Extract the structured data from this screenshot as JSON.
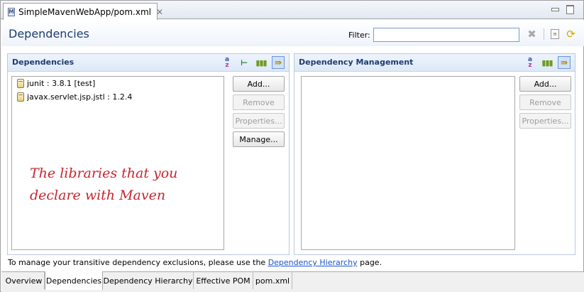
{
  "window": {
    "tab_title": "SimpleMavenWebApp/pom.xml",
    "tab_icon": "maven-m-icon",
    "close_glyph": "✕"
  },
  "header": {
    "title": "Dependencies",
    "filter_label": "Filter:",
    "filter_value": ""
  },
  "dependencies": {
    "title": "Dependencies",
    "items": [
      {
        "label": "junit : 3.8.1 [test]"
      },
      {
        "label": "javax.servlet.jsp.jstl : 1.2.4"
      }
    ],
    "buttons": {
      "add": "Add...",
      "remove": "Remove",
      "properties": "Properties...",
      "manage": "Manage..."
    }
  },
  "dependency_management": {
    "title": "Dependency Management",
    "items": [],
    "buttons": {
      "add": "Add...",
      "remove": "Remove",
      "properties": "Properties..."
    }
  },
  "annotation": {
    "line1": "The libraries that you",
    "line2": "declare with Maven",
    "color": "#c8242f"
  },
  "info": {
    "prefix": "To manage your transitive dependency exclusions, please use the ",
    "link": "Dependency Hierarchy",
    "suffix": " page."
  },
  "page_tabs": [
    {
      "label": "Overview",
      "active": false
    },
    {
      "label": "Dependencies",
      "active": true
    },
    {
      "label": "Dependency Hierarchy",
      "active": false
    },
    {
      "label": "Effective POM",
      "active": false
    },
    {
      "label": "pom.xml",
      "active": false
    }
  ],
  "colors": {
    "title_blue": "#1f3c6e",
    "link_blue": "#1a56c4"
  }
}
